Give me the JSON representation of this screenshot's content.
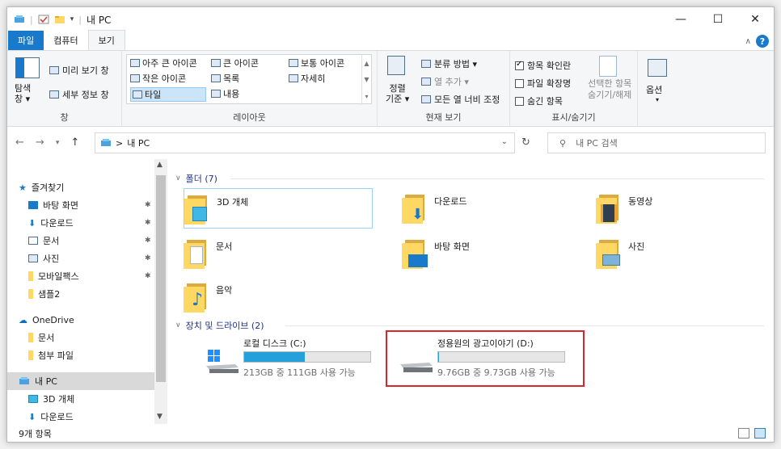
{
  "window": {
    "title": "내 PC"
  },
  "title_bar": {
    "minimize": "—",
    "maximize": "☐",
    "close": "✕"
  },
  "ribbon_tabs": [
    "파일",
    "컴퓨터",
    "보기"
  ],
  "ribbon": {
    "pane_group": {
      "nav_pane": "탐색\n창 ▾",
      "preview": "미리 보기 창",
      "details": "세부 정보 창",
      "label": "창"
    },
    "layout_group": {
      "items": [
        "아주 큰 아이콘",
        "큰 아이콘",
        "보통 아이콘",
        "작은 아이콘",
        "목록",
        "자세히",
        "타일",
        "내용"
      ],
      "label": "레이아웃"
    },
    "current_view_group": {
      "sort": "정렬\n기준 ▾",
      "group_by": "분류 방법 ▾",
      "add_column": "열 추가 ▾",
      "fit_columns": "모든 열 너비 조정",
      "label": "현재 보기"
    },
    "show_hide_group": {
      "item_checkboxes": "항목 확인란",
      "extensions": "파일 확장명",
      "hidden_items": "숨긴 항목",
      "hide_selected": "선택한 항목\n숨기기/해제",
      "label": "표시/숨기기"
    },
    "options_group": {
      "options": "옵션"
    }
  },
  "address": {
    "path": "내 PC",
    "separator": ">"
  },
  "search": {
    "placeholder": "내 PC 검색"
  },
  "nav_pane": {
    "quick_access": "즐겨찾기",
    "items": [
      "바탕 화면",
      "다운로드",
      "문서",
      "사진",
      "모바일팩스",
      "샘플2",
      "OneDrive",
      "문서",
      "첨부 파일",
      "내 PC",
      "3D 개체",
      "다운로드"
    ]
  },
  "folders_section": {
    "title": "폴더 (7)"
  },
  "folders": [
    "3D 개체",
    "다운로드",
    "동영상",
    "문서",
    "바탕 화면",
    "사진",
    "음악"
  ],
  "drives_section": {
    "title": "장치 및 드라이브 (2)"
  },
  "drives": [
    {
      "name": "로컬 디스크 (C:)",
      "free": "213GB 중 111GB 사용 가능",
      "used_fraction": 0.48
    },
    {
      "name": "정용원의 광고이야기 (D:)",
      "free": "9.76GB 중 9.73GB 사용 가능",
      "used_fraction": 0.003
    }
  ],
  "status": {
    "count": "9개 항목"
  },
  "colors": {
    "accent": "#1979ca",
    "folder": "#ffd863",
    "drive_bar": "#26a0da",
    "highlight": "#d9262a"
  }
}
